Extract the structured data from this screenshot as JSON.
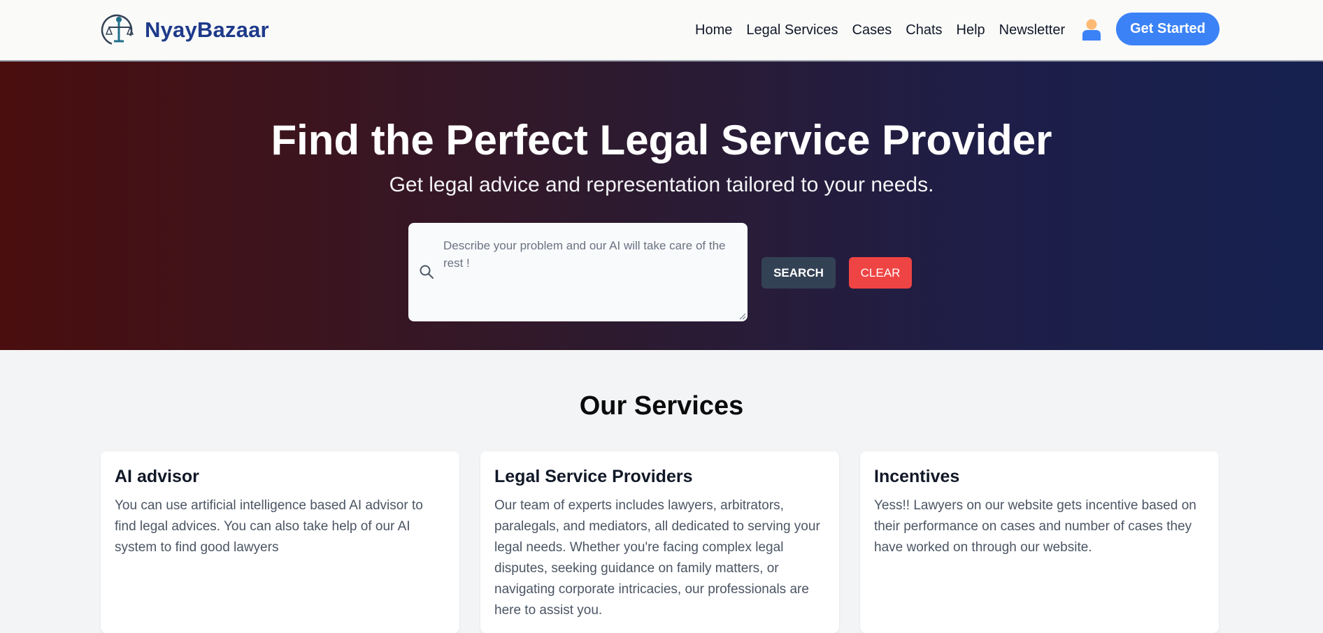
{
  "brand": {
    "name": "NyayBazaar",
    "logo_icon": "scales-of-justice-icon"
  },
  "nav": {
    "items": [
      {
        "label": "Home"
      },
      {
        "label": "Legal Services"
      },
      {
        "label": "Cases"
      },
      {
        "label": "Chats"
      },
      {
        "label": "Help"
      },
      {
        "label": "Newsletter"
      }
    ],
    "user_icon": "user-avatar-icon",
    "cta_label": "Get Started"
  },
  "hero": {
    "title": "Find the Perfect Legal Service Provider",
    "subtitle": "Get legal advice and representation tailored to your needs.",
    "search": {
      "placeholder": "Describe your problem and our AI will take care of the rest !",
      "value": "",
      "search_label": "SEARCH",
      "clear_label": "CLEAR"
    }
  },
  "services": {
    "title": "Our Services",
    "cards": [
      {
        "title": "AI advisor",
        "text": "You can use artificial intelligence based AI advisor to find legal advices. You can also take help of our AI system to find good lawyers"
      },
      {
        "title": "Legal Service Providers",
        "text": "Our team of experts includes lawyers, arbitrators, paralegals, and mediators, all dedicated to serving your legal needs. Whether you're facing complex legal disputes, seeking guidance on family matters, or navigating corporate intricacies, our professionals are here to assist you."
      },
      {
        "title": "Incentives",
        "text": "Yess!! Lawyers on our website gets incentive based on their performance on cases and number of cases they have worked on through our website."
      }
    ]
  },
  "colors": {
    "brand": "#1e3a8a",
    "accent": "#3b82f6",
    "search_button": "#334155",
    "clear_button": "#ef4444"
  }
}
